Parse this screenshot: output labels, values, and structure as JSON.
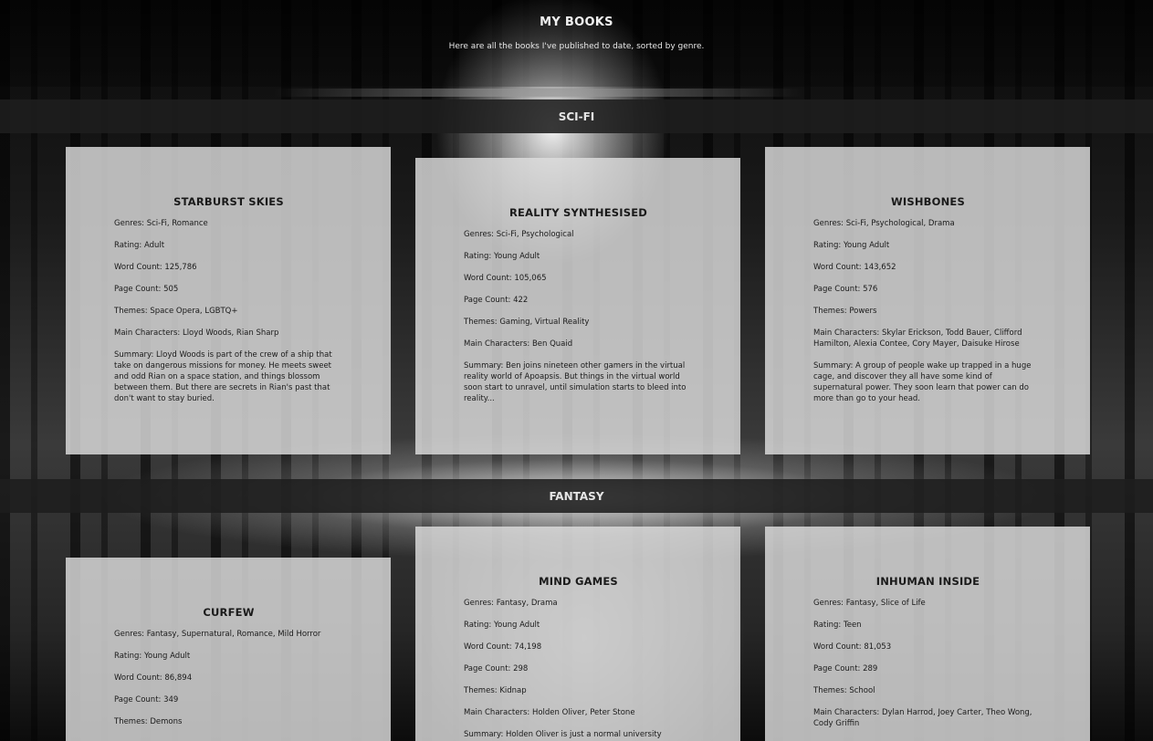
{
  "page": {
    "title": "MY BOOKS",
    "subtitle": "Here are all the books I've published to date, sorted by genre."
  },
  "sections": [
    {
      "name": "SCI-FI",
      "books": [
        {
          "title": "STARBURST SKIES",
          "genres": "Genres: Sci-Fi, Romance",
          "rating": "Rating: Adult",
          "word_count": "Word Count: 125,786",
          "page_count": "Page Count: 505",
          "themes": "Themes: Space Opera, LGBTQ+",
          "characters": "Main Characters: Lloyd Woods, Rian Sharp",
          "summary": "Summary: Lloyd Woods is part of the crew of a ship that take on dangerous missions for money. He meets sweet and odd Rian on a space station, and things blossom between them. But there are secrets in Rian's past that don't want to stay buried."
        },
        {
          "title": "REALITY SYNTHESISED",
          "genres": "Genres: Sci-Fi, Psychological",
          "rating": "Rating: Young Adult",
          "word_count": "Word Count: 105,065",
          "page_count": "Page Count: 422",
          "themes": "Themes: Gaming, Virtual Reality",
          "characters": "Main Characters: Ben Quaid",
          "summary": "Summary: Ben joins nineteen other gamers in the virtual reality world of Apoapsis. But things in the virtual world soon start to unravel, until simulation starts to bleed into reality..."
        },
        {
          "title": "WISHBONES",
          "genres": "Genres: Sci-Fi, Psychological, Drama",
          "rating": "Rating: Young Adult",
          "word_count": "Word Count: 143,652",
          "page_count": "Page Count: 576",
          "themes": "Themes: Powers",
          "characters": "Main Characters: Skylar Erickson, Todd Bauer, Clifford Hamilton, Alexia Contee, Cory Mayer, Daisuke Hirose",
          "summary": "Summary: A group of people wake up trapped in a huge cage, and discover they all have some kind of supernatural power. They soon learn that power can do more than go to your head."
        }
      ]
    },
    {
      "name": "FANTASY",
      "books": [
        {
          "title": "CURFEW",
          "genres": "Genres: Fantasy, Supernatural, Romance, Mild Horror",
          "rating": "Rating: Young Adult",
          "word_count": "Word Count: 86,894",
          "page_count": "Page Count: 349",
          "themes": "Themes: Demons"
        },
        {
          "title": "MIND GAMES",
          "genres": "Genres: Fantasy, Drama",
          "rating": "Rating: Young Adult",
          "word_count": "Word Count: 74,198",
          "page_count": "Page Count: 298",
          "themes": "Themes: Kidnap",
          "characters": "Main Characters: Holden Oliver, Peter Stone",
          "summary": "Summary: Holden Oliver is just a normal university student. Or"
        },
        {
          "title": "INHUMAN INSIDE",
          "genres": "Genres: Fantasy, Slice of Life",
          "rating": "Rating: Teen",
          "word_count": "Word Count: 81,053",
          "page_count": "Page Count: 289",
          "themes": "Themes: School",
          "characters": "Main Characters: Dylan Harrod, Joey Carter, Theo Wong, Cody Griffin"
        }
      ]
    }
  ]
}
